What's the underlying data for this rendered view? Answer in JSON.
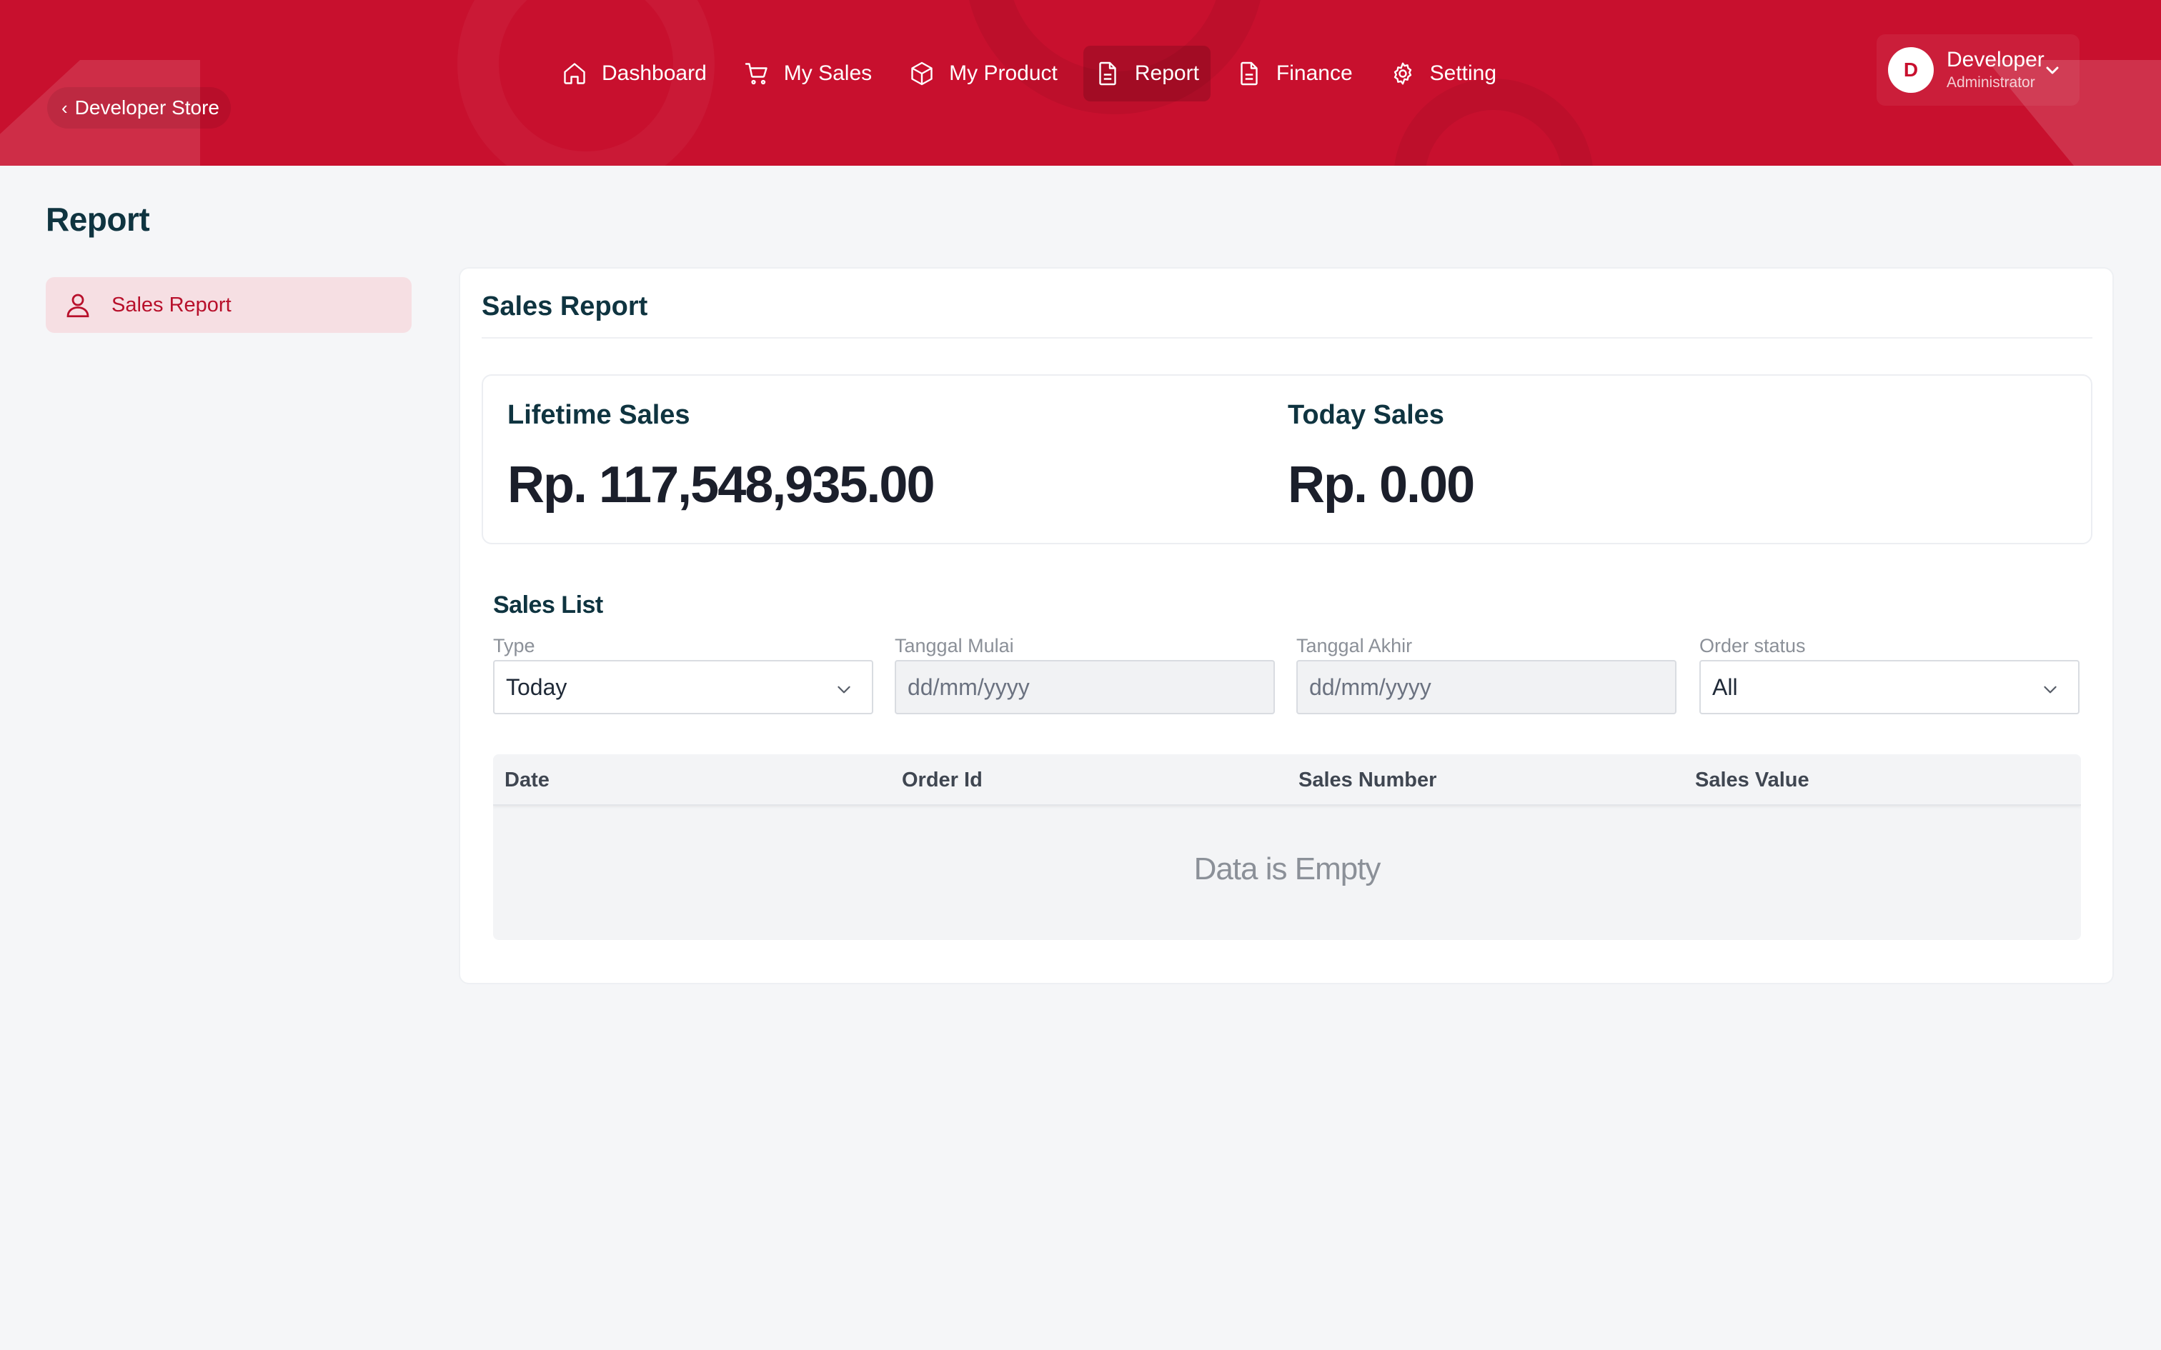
{
  "header": {
    "back_store_label": "Developer Store",
    "nav": [
      {
        "label": "Dashboard",
        "icon": "home-icon"
      },
      {
        "label": "My Sales",
        "icon": "cart-icon"
      },
      {
        "label": "My Product",
        "icon": "box-icon"
      },
      {
        "label": "Report",
        "icon": "document-icon",
        "active": true
      },
      {
        "label": "Finance",
        "icon": "document-icon"
      },
      {
        "label": "Setting",
        "icon": "gear-icon"
      }
    ],
    "user": {
      "initial": "D",
      "name": "Developer",
      "role": "Administrator"
    }
  },
  "page": {
    "title": "Report"
  },
  "sidebar": {
    "items": [
      {
        "label": "Sales Report",
        "icon": "user-icon",
        "active": true
      }
    ]
  },
  "report": {
    "title": "Sales Report",
    "lifetime_label": "Lifetime Sales",
    "lifetime_value": "Rp. 117,548,935.00",
    "today_label": "Today Sales",
    "today_value": "Rp. 0.00"
  },
  "sales_list": {
    "title": "Sales List",
    "filters": {
      "type_label": "Type",
      "type_value": "Today",
      "start_label": "Tanggal Mulai",
      "start_placeholder": "dd/mm/yyyy",
      "end_label": "Tanggal Akhir",
      "end_placeholder": "dd/mm/yyyy",
      "status_label": "Order status",
      "status_value": "All"
    },
    "columns": [
      "Date",
      "Order Id",
      "Sales Number",
      "Sales Value"
    ],
    "empty_message": "Data is Empty"
  },
  "colors": {
    "brand": "#c8102e",
    "heading": "#0f3440",
    "sidebar_active_bg": "#f6dfe3"
  }
}
